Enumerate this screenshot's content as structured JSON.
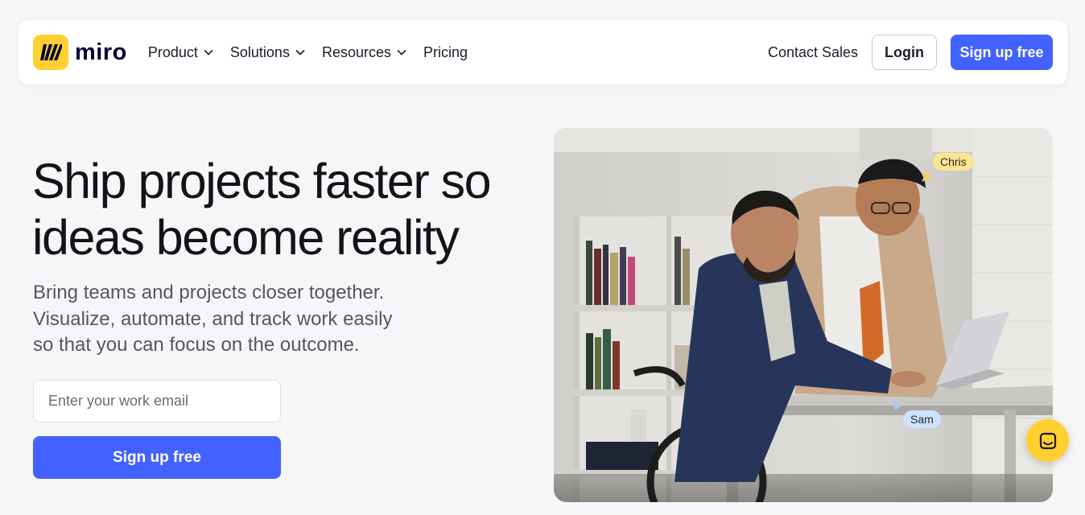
{
  "brand": {
    "name": "miro",
    "logo_color": "#ffd02f"
  },
  "nav": {
    "links": [
      {
        "label": "Product",
        "has_dropdown": true
      },
      {
        "label": "Solutions",
        "has_dropdown": true
      },
      {
        "label": "Resources",
        "has_dropdown": true
      },
      {
        "label": "Pricing",
        "has_dropdown": false
      }
    ],
    "contact_label": "Contact Sales",
    "login_label": "Login",
    "signup_label": "Sign up free"
  },
  "hero": {
    "title_line1": "Ship projects faster so",
    "title_line2": "ideas become reality",
    "subtitle_line1": "Bring teams and projects closer together.",
    "subtitle_line2": "Visualize, automate, and track work easily",
    "subtitle_line3": "so that you can focus on the outcome.",
    "email_placeholder": "Enter your work email",
    "signup_label": "Sign up free"
  },
  "image": {
    "cursor_tags": [
      {
        "label": "Chris",
        "color": "#fbe58e",
        "arrow_color": "#f2d060"
      },
      {
        "label": "Sam",
        "color": "#cfe2ff",
        "arrow_color": "#a9c8f5"
      }
    ]
  },
  "colors": {
    "accent": "#4262ff",
    "background": "#f6f6f9"
  },
  "chat": {
    "icon": "chat-icon"
  }
}
